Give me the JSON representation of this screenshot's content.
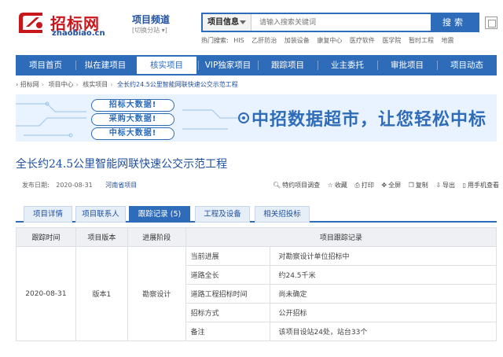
{
  "header": {
    "logo_cn": "招标网",
    "logo_en": "zhaobiao.cn",
    "channel": "项目频道",
    "channel_switch": "[切换分站 ▾]",
    "search_category": "项目信息",
    "search_placeholder": "请输入搜索关键词",
    "search_button": "搜索",
    "hot_label": "热门搜索:",
    "hot_items": [
      "HIS",
      "乙肝防治",
      "加装设备",
      "康复中心",
      "医疗软件",
      "医学院",
      "暂时工程",
      "地震"
    ]
  },
  "nav": {
    "items": [
      "项目首页",
      "拟在建项目",
      "核实项目",
      "VIP独家项目",
      "跟踪项目",
      "业主委托",
      "审批项目",
      "项目动态"
    ],
    "active_index": 2
  },
  "breadcrumb": [
    "招标网",
    "项目中心",
    "核实项目",
    "全长约24.5公里智能网联快速公交示范工程"
  ],
  "banner": {
    "tags": [
      "招标大数据!",
      "采购大数据!",
      "中标大数据!"
    ],
    "slogan": "中招数据超市，让您轻松中标"
  },
  "project": {
    "title": "全长约24.5公里智能网联快速公交示范工程",
    "publish_label": "发布日期:",
    "publish_date": "2020-08-31",
    "region": "河南省项目"
  },
  "tools": [
    "特约项目调查",
    "收藏",
    "打印",
    "全屏",
    "复制",
    "导出",
    "用手机查看"
  ],
  "tabs": [
    "项目详情",
    "项目联系人",
    "跟踪记录 (5)",
    "工程及设备",
    "相关招投标"
  ],
  "active_tab": 2,
  "table": {
    "headers": [
      "跟踪时间",
      "项目版本",
      "进展阶段",
      "项目跟踪记录"
    ],
    "time": "2020-08-31",
    "version": "版本1",
    "stage": "勘察设计",
    "records": [
      {
        "label": "当前进展",
        "value": "对勘察设计单位招标中"
      },
      {
        "label": "道路全长",
        "value": "约24.5千米"
      },
      {
        "label": "道路工程招标时间",
        "value": "尚未确定"
      },
      {
        "label": "招标方式",
        "value": "公开招标"
      },
      {
        "label": "备注",
        "value": "该项目设站24处，站台33个"
      }
    ]
  },
  "colors": {
    "brand_blue": "#2e6cba",
    "brand_red": "#c8161d",
    "link_blue": "#1f4fa0"
  }
}
